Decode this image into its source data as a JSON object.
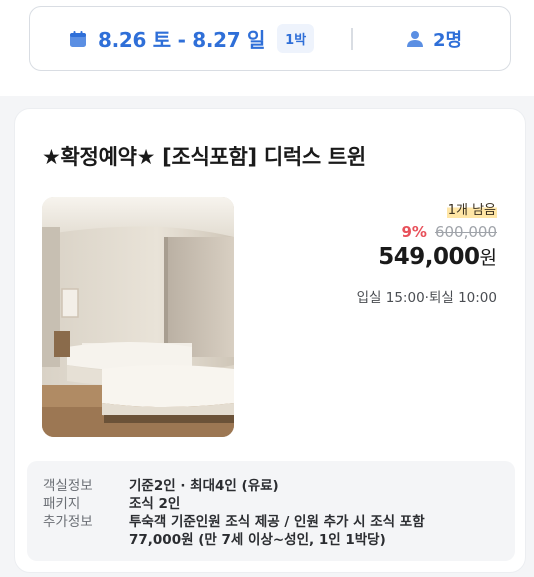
{
  "search": {
    "dates": "8.26 토 - 8.27 일",
    "nights": "1박",
    "guests": "2명",
    "accent_color": "#2f6fd8",
    "calendar_icon": "calendar-icon",
    "guest_icon": "person-icon"
  },
  "room": {
    "title": "★확정예약★ [조식포함] 디럭스 트윈",
    "remaining": "1개 남음",
    "discount": "9%",
    "original_price": "600,000",
    "price": "549,000",
    "currency": "원",
    "checkin_checkout": "입실 15:00·퇴실 10:00",
    "discount_color": "#e8515b"
  },
  "info": [
    {
      "label": "객실정보",
      "value": "기준2인 · 최대4인 (유료)"
    },
    {
      "label": "패키지",
      "value": "조식 2인"
    },
    {
      "label": "추가정보",
      "value": "투숙객 기준인원 조식 제공 / 인원 추가 시 조식 포함"
    },
    {
      "label": "",
      "value": "77,000원 (만 7세 이상~성인, 1인 1박당)"
    }
  ]
}
